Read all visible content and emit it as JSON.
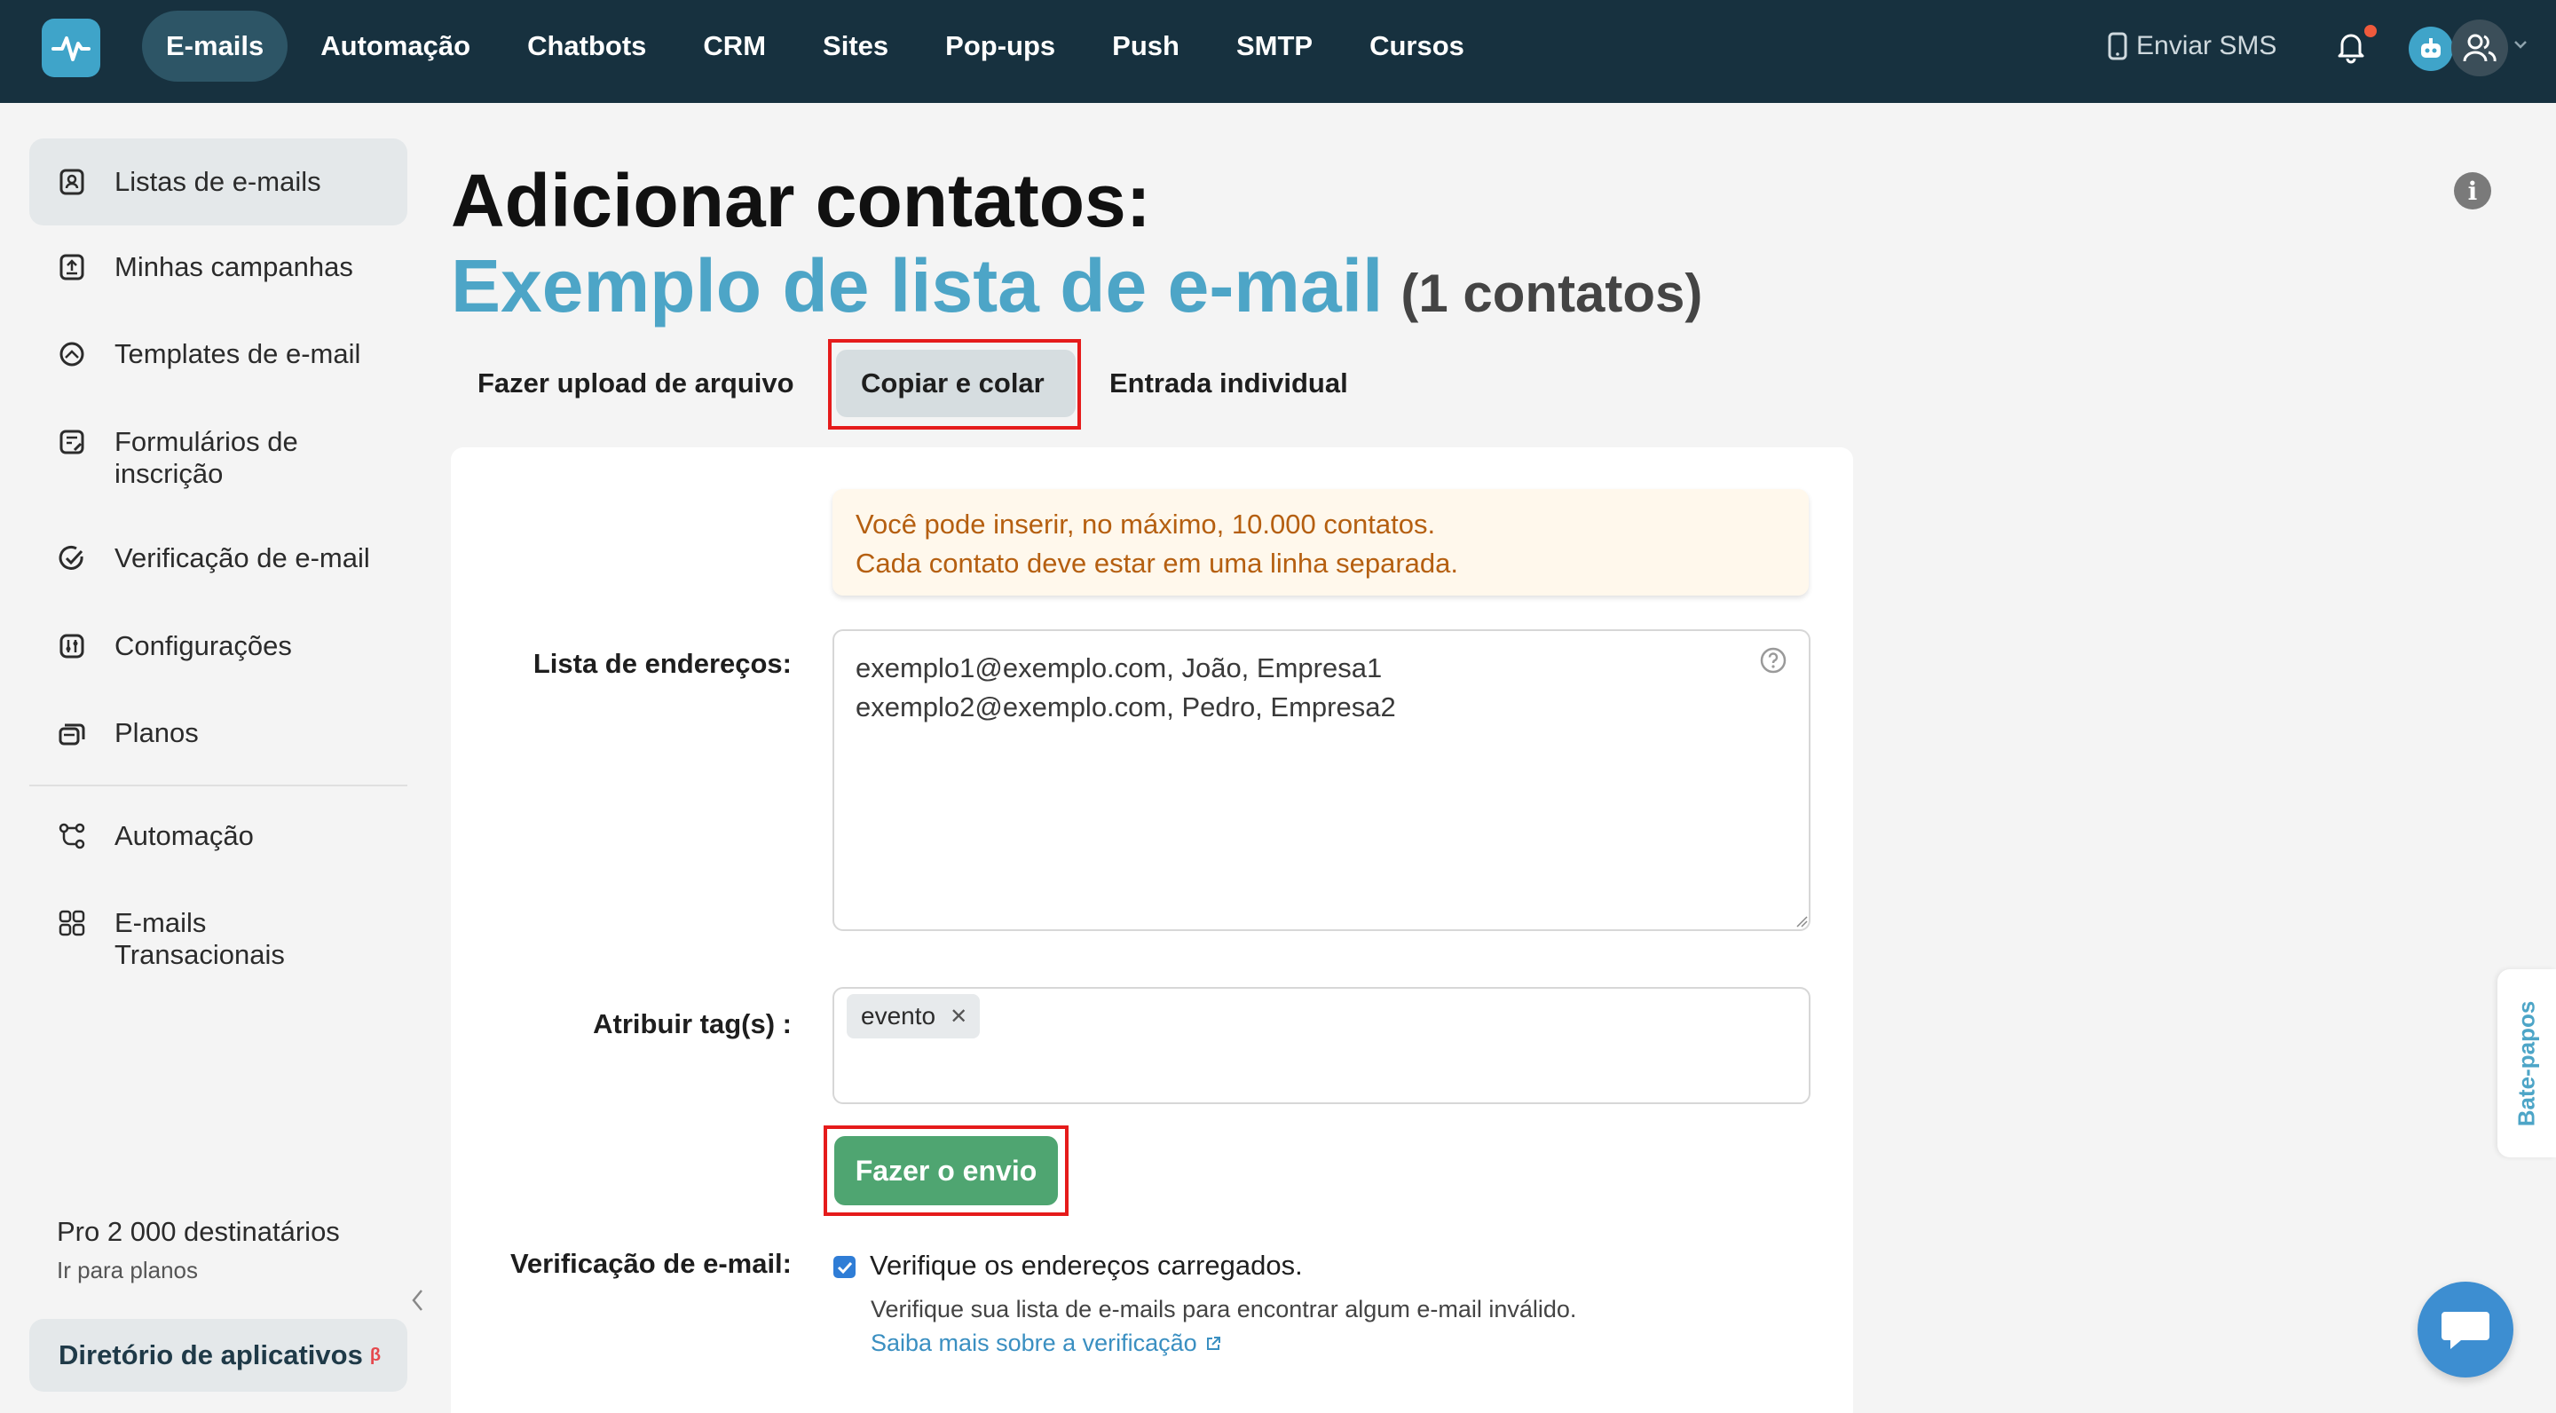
{
  "topnav": {
    "items": [
      "E-mails",
      "Automação",
      "Chatbots",
      "CRM",
      "Sites",
      "Pop-ups",
      "Push",
      "SMTP",
      "Cursos"
    ],
    "active_index": 0,
    "sms_label": "Enviar SMS"
  },
  "sidebar": {
    "items": [
      {
        "label": "Listas de e-mails",
        "icon": "contacts-icon"
      },
      {
        "label": "Minhas campanhas",
        "icon": "campaign-upload-icon"
      },
      {
        "label": "Templates de e-mail",
        "icon": "template-icon"
      },
      {
        "label": "Formulários de inscrição",
        "icon": "form-icon"
      },
      {
        "label": "Verificação de e-mail",
        "icon": "check-circle-icon"
      },
      {
        "label": "Configurações",
        "icon": "settings-icon"
      },
      {
        "label": "Planos",
        "icon": "plans-icon"
      },
      {
        "label": "Automação",
        "icon": "automation-icon"
      },
      {
        "label": "E-mails Transacionais",
        "icon": "grid-icon"
      }
    ],
    "active_index": 0,
    "pro_plan": "Pro 2 000 destinatários",
    "plans_link": "Ir para planos",
    "app_directory": "Diretório de aplicativos",
    "beta_mark": "β"
  },
  "page": {
    "title": "Adicionar contatos:",
    "list_name": "Exemplo de lista de e-mail",
    "contact_count": "(1 contatos)"
  },
  "tabs": [
    "Fazer upload de arquivo",
    "Copiar e colar",
    "Entrada individual"
  ],
  "active_tab": 1,
  "form": {
    "notice_line1": "Você pode inserir, no máximo, 10.000 contatos.",
    "notice_line2": "Cada contato deve estar em uma linha separada.",
    "addresses_label": "Lista de endereços:",
    "address_line1": "exemplo1@exemplo.com, João, Empresa1",
    "address_line2": "exemplo2@exemplo.com, Pedro, Empresa2",
    "tags_label": "Atribuir tag(s) :",
    "tags": [
      "evento"
    ],
    "submit_label": "Fazer o envio",
    "verification_label": "Verificação de e-mail:",
    "verify_checkbox_label": "Verifique os endereços carregados.",
    "verify_checked": true,
    "verify_description": "Verifique sua lista de e-mails para encontrar algum e-mail inválido.",
    "verify_link": "Saiba mais sobre a verificação"
  },
  "chat": {
    "tab_label": "Bate-papos"
  },
  "colors": {
    "topbar": "#17313f",
    "accent": "#4da5c7",
    "submit": "#4fa571",
    "highlight": "#e51b1b",
    "notice_text": "#b55f10"
  }
}
